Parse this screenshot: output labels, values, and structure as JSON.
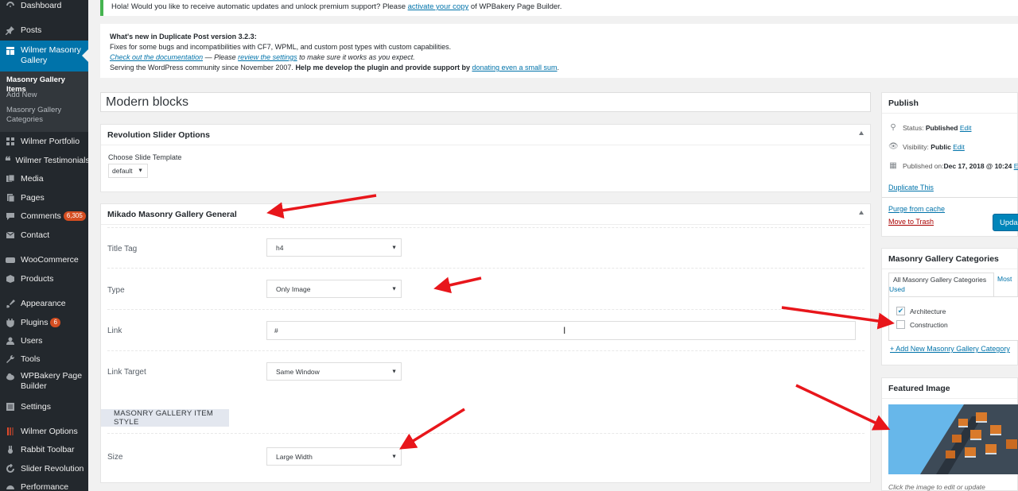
{
  "admin_menu": {
    "items": [
      {
        "key": "dashboard",
        "label": "Dashboard"
      },
      {
        "key": "posts",
        "label": "Posts"
      },
      {
        "key": "masonry",
        "label": "Wilmer Masonry Gallery"
      },
      {
        "key": "portfolio",
        "label": "Wilmer Portfolio"
      },
      {
        "key": "testimonials",
        "label": "Wilmer Testimonials"
      },
      {
        "key": "media",
        "label": "Media"
      },
      {
        "key": "pages",
        "label": "Pages"
      },
      {
        "key": "comments",
        "label": "Comments",
        "badge": "6,305"
      },
      {
        "key": "contact",
        "label": "Contact"
      },
      {
        "key": "woocommerce",
        "label": "WooCommerce"
      },
      {
        "key": "products",
        "label": "Products"
      },
      {
        "key": "appearance",
        "label": "Appearance"
      },
      {
        "key": "plugins",
        "label": "Plugins",
        "badge": "6"
      },
      {
        "key": "users",
        "label": "Users"
      },
      {
        "key": "tools",
        "label": "Tools"
      },
      {
        "key": "wpbakery",
        "label": "WPBakery Page Builder"
      },
      {
        "key": "settings",
        "label": "Settings"
      },
      {
        "key": "wilmer_options",
        "label": "Wilmer Options"
      },
      {
        "key": "rabbit",
        "label": "Rabbit Toolbar"
      },
      {
        "key": "slider",
        "label": "Slider Revolution"
      },
      {
        "key": "performance",
        "label": "Performance"
      }
    ],
    "submenu": [
      {
        "label": "Masonry Gallery Items",
        "active": true
      },
      {
        "label": "Add New"
      },
      {
        "label": "Masonry Gallery Categories"
      }
    ]
  },
  "notices": {
    "wpbakery": {
      "text_before": "Hola! Would you like to receive automatic updates and unlock premium support? Please ",
      "link": "activate your copy",
      "text_after": " of WPBakery Page Builder."
    },
    "duplicate_post": {
      "heading": "What's new in Duplicate Post version 3.2.3:",
      "line1": "Fixes for some bugs and incompatibilities with CF7, WPML, and custom post types with custom capabilities.",
      "line2_link1": "Check out the documentation",
      "line2_mid": " — Please ",
      "line2_link2": "review the settings",
      "line2_end": " to make sure it works as you expect.",
      "line3_start": "Serving the WordPress community since November 2007. ",
      "line3_bold": "Help me develop the plugin and provide support by ",
      "line3_link": "donating even a small sum",
      "line3_end": "."
    }
  },
  "post_title": "Modern blocks",
  "rev_slider": {
    "title": "Revolution Slider Options",
    "label": "Choose Slide Template",
    "value": "default"
  },
  "mikado": {
    "title": "Mikado Masonry Gallery General",
    "fields": {
      "title_tag": {
        "label": "Title Tag",
        "value": "h4"
      },
      "type": {
        "label": "Type",
        "value": "Only Image"
      },
      "link": {
        "label": "Link",
        "value": "#"
      },
      "link_target": {
        "label": "Link Target",
        "value": "Same Window"
      },
      "size": {
        "label": "Size",
        "value": "Large Width"
      }
    },
    "section_title": "MASONRY GALLERY ITEM STYLE"
  },
  "publish": {
    "title": "Publish",
    "status_label": "Status: ",
    "status_value": "Published",
    "visibility_label": "Visibility: ",
    "visibility_value": "Public",
    "published_label": "Published on: ",
    "published_value": "Dec 17, 2018 @ 10:24",
    "edit": "Edit",
    "edit_cut": "E",
    "duplicate": "Duplicate This",
    "purge": "Purge from cache",
    "trash": "Move to Trash",
    "update": "Upda"
  },
  "categories": {
    "title": "Masonry Gallery Categories",
    "tab_all": "All Masonry Gallery Categories",
    "tab_most_used_1": "Most",
    "tab_most_used_2": "Used",
    "items": [
      {
        "label": "Architecture",
        "checked": true
      },
      {
        "label": "Construction",
        "checked": false
      }
    ],
    "add_new": "+ Add New Masonry Gallery Category"
  },
  "featured": {
    "title": "Featured Image",
    "caption": "Click the image to edit or update"
  },
  "colors": {
    "menu_bg": "#23282d",
    "menu_active": "#0073aa",
    "link": "#0073aa",
    "annotation_arrow": "#e8161b",
    "notice_success": "#46b450",
    "trash": "#a00"
  }
}
